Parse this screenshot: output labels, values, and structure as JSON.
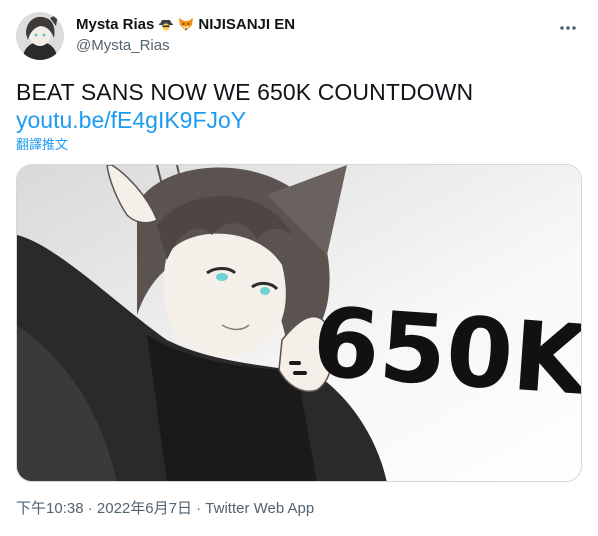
{
  "author": {
    "display_name": "Mysta Rias",
    "name_suffix": "NIJISANJI EN",
    "handle": "@Mysta_Rias",
    "emoji_icons": [
      "detective-emoji-icon",
      "fox-emoji-icon"
    ]
  },
  "tweet": {
    "text": "BEAT SANS NOW WE 650K COUNTDOWN",
    "link": "youtu.be/fE4gIK9FJoY",
    "translate_label": "翻譯推文",
    "media_overlay_text": "650K"
  },
  "meta": {
    "time": "下午10:38",
    "separator": "·",
    "date": "2022年6月7日",
    "app": "Twitter Web App"
  },
  "colors": {
    "link": "#1d9bf0",
    "secondary_text": "#536471",
    "border": "#cfd9de"
  }
}
